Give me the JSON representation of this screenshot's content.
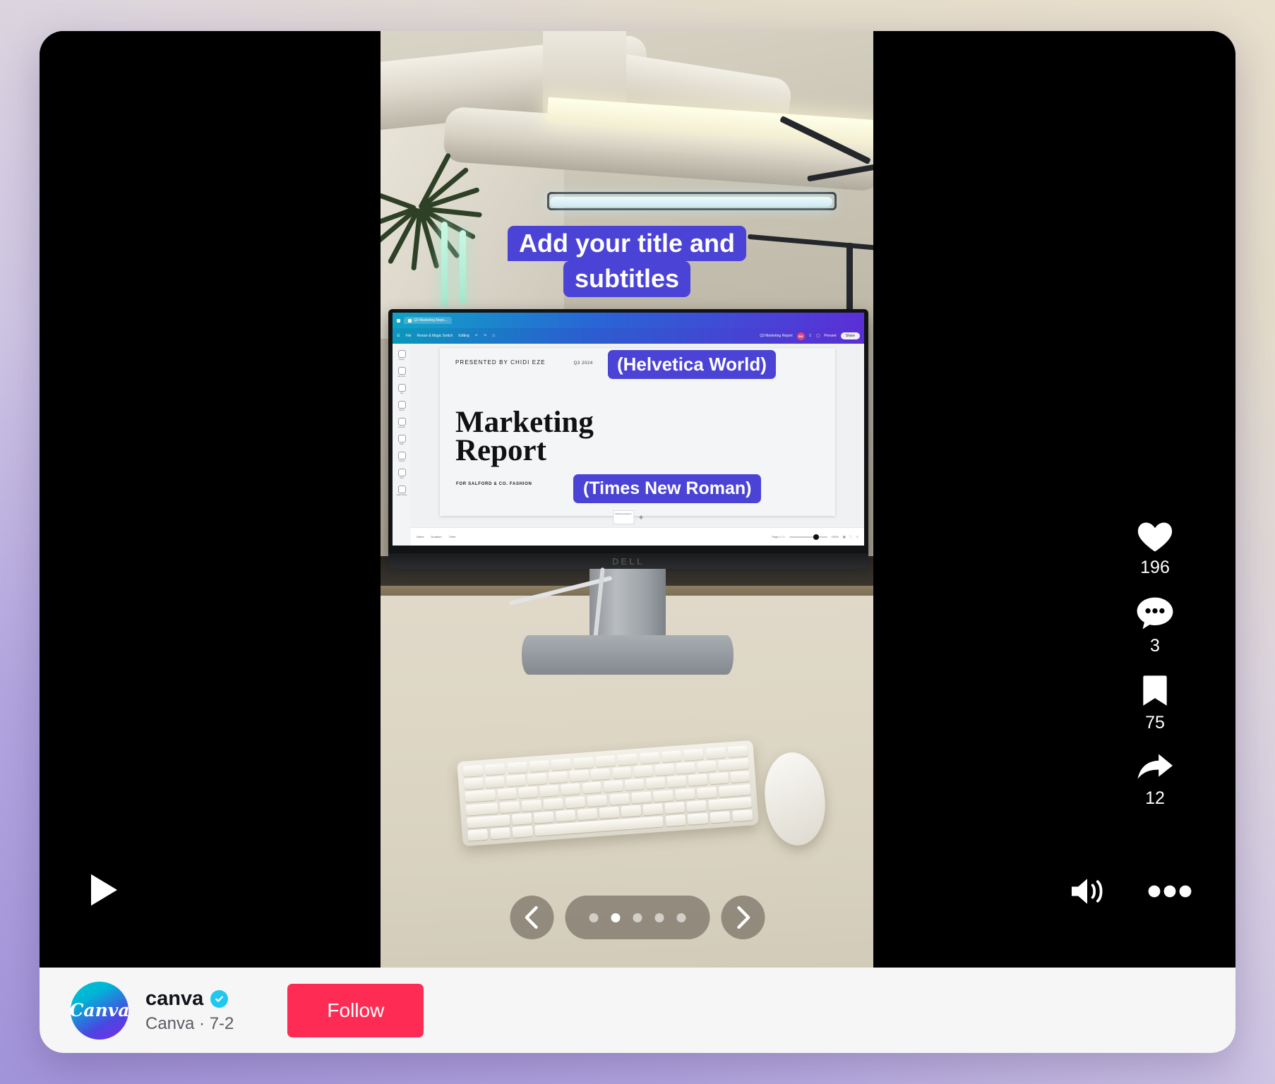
{
  "post": {
    "subtitle_lines": [
      "Add your title and",
      "subtitles"
    ],
    "badges": {
      "helvetica": "(Helvetica World)",
      "times": "(Times New Roman)"
    }
  },
  "actions": [
    {
      "icon": "heart-icon",
      "name": "like",
      "count": "196"
    },
    {
      "icon": "comment-icon",
      "name": "comment",
      "count": "3"
    },
    {
      "icon": "bookmark-icon",
      "name": "bookmark",
      "count": "75"
    },
    {
      "icon": "share-icon",
      "name": "share",
      "count": "12"
    }
  ],
  "player": {
    "play_icon": "play-icon",
    "volume_icon": "volume-on-icon",
    "more_icon": "more-options-icon"
  },
  "carousel": {
    "prev_label": "‹",
    "next_label": "›",
    "total_dots": 5,
    "active_index": 1
  },
  "profile": {
    "avatar_text": "Canva",
    "username": "canva",
    "verified": true,
    "verified_icon": "verified-check-icon",
    "meta": "Canva · 7-2",
    "follow_label": "Follow"
  },
  "editor": {
    "tab_title": "Q3 Marketing Repo...",
    "toolbar": {
      "file": "File",
      "resize": "Resize & Magic Switch",
      "editing": "Editing",
      "undo_icon": "undo-icon",
      "redo_icon": "redo-icon",
      "home_icon": "home-icon"
    },
    "doc_title": "Q3 Marketing Report",
    "avatar_initials": "SW",
    "present_label": "Present",
    "share_label": "Share",
    "rail": [
      {
        "label": "Design",
        "icon": "design-icon"
      },
      {
        "label": "Elements",
        "icon": "elements-icon"
      },
      {
        "label": "Text",
        "icon": "text-icon"
      },
      {
        "label": "Brand",
        "icon": "brand-icon"
      },
      {
        "label": "Uploads",
        "icon": "uploads-icon"
      },
      {
        "label": "Draw",
        "icon": "draw-icon"
      },
      {
        "label": "Projects",
        "icon": "projects-icon"
      },
      {
        "label": "Apps",
        "icon": "apps-icon"
      },
      {
        "label": "Magic Media",
        "icon": "magic-media-icon"
      }
    ],
    "slide": {
      "presented_by": "PRESENTED BY CHIDI EZE",
      "quarter": "Q3 2024",
      "title_line1": "Marketing",
      "title_line2": "Report",
      "subtitle": "FOR SALFORD & CO. FASHION"
    },
    "status_bar": {
      "notes": "Notes",
      "duration": "Duration",
      "timer": "Timer",
      "page": "Page 1 / 1",
      "zoom": "100%"
    },
    "page_thumb_label": "Marketing Report",
    "add_page": "+"
  },
  "monitor": {
    "brand": "DELL"
  },
  "colors": {
    "subtitle_highlight": "#4b43d6",
    "follow_button": "#fe2c55",
    "verified_badge": "#20c8f0",
    "avatar_gradient_start": "#00c4cc",
    "avatar_gradient_end": "#7d2ae8"
  }
}
